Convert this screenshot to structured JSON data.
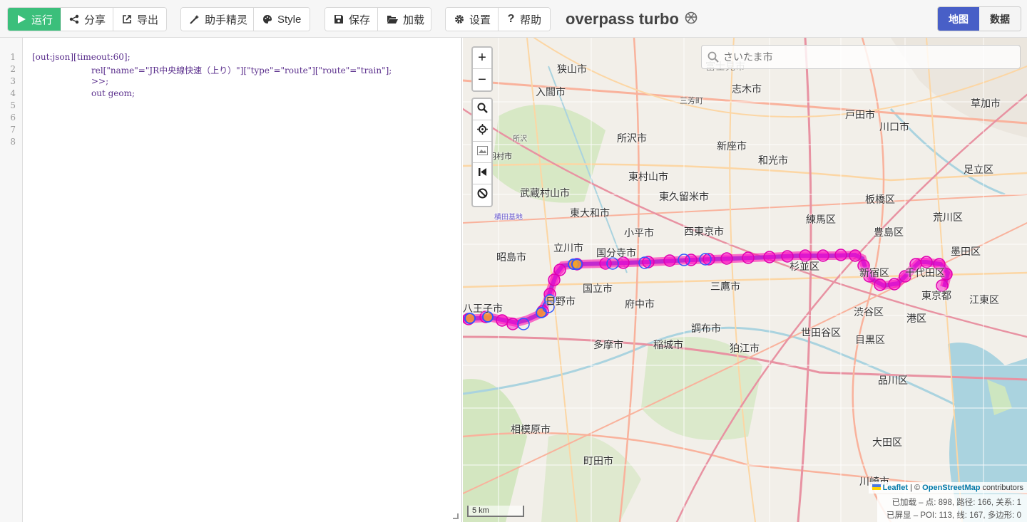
{
  "toolbar": {
    "run": "运行",
    "share": "分享",
    "export": "导出",
    "wizard": "助手精灵",
    "style": "Style",
    "save": "保存",
    "load": "加载",
    "settings": "设置",
    "help": "帮助"
  },
  "app_title": "overpass turbo",
  "view_tabs": {
    "map": "地图",
    "data": "数据"
  },
  "editor": {
    "line_numbers": [
      "1",
      "2",
      "3",
      "4",
      "5",
      "6",
      "7",
      "8"
    ],
    "lines": [
      "[out:json][timeout:60];",
      "rel[\"name\"=\"JR中央線快速（上り）\"][\"type\"=\"route\"][\"route\"=\"train\"];",
      ">>;",
      "out geom;"
    ]
  },
  "map": {
    "search_placeholder": "さいたま市",
    "attribution": {
      "leaflet": "Leaflet",
      "sep": " | © ",
      "osm": "OpenStreetMap",
      "contrib": " contributors"
    },
    "stats": {
      "loaded": "已加载 – 点: 898, 路径: 166, 关系: 1",
      "displayed": "已屏显 – POI: 113, 线: 167, 多边形: 0"
    },
    "scale": "5 km",
    "labels": [
      {
        "t": "狭山市"
      },
      {
        "t": "入間市"
      },
      {
        "t": "富士見市"
      },
      {
        "t": "志木市"
      },
      {
        "t": "三芳町"
      },
      {
        "t": "戸田市"
      },
      {
        "t": "川口市"
      },
      {
        "t": "草加市"
      },
      {
        "t": "所沢市"
      },
      {
        "t": "新座市"
      },
      {
        "t": "和光市"
      },
      {
        "t": "羽村市"
      },
      {
        "t": "東村山市"
      },
      {
        "t": "足立区"
      },
      {
        "t": "武蔵村山市"
      },
      {
        "t": "東久留米市"
      },
      {
        "t": "板橋区"
      },
      {
        "t": "東大和市"
      },
      {
        "t": "練馬区"
      },
      {
        "t": "荒川区"
      },
      {
        "t": "小平市"
      },
      {
        "t": "西東京市"
      },
      {
        "t": "豊島区"
      },
      {
        "t": "立川市"
      },
      {
        "t": "国分寺市"
      },
      {
        "t": "墨田区"
      },
      {
        "t": "昭島市"
      },
      {
        "t": "杉並区"
      },
      {
        "t": "新宿区"
      },
      {
        "t": "千代田区"
      },
      {
        "t": "国立市"
      },
      {
        "t": "三鷹市"
      },
      {
        "t": "東京都"
      },
      {
        "t": "江東区"
      },
      {
        "t": "日野市"
      },
      {
        "t": "府中市"
      },
      {
        "t": "渋谷区"
      },
      {
        "t": "港区"
      },
      {
        "t": "八王子市"
      },
      {
        "t": "調布市"
      },
      {
        "t": "世田谷区"
      },
      {
        "t": "目黒区"
      },
      {
        "t": "多摩市"
      },
      {
        "t": "稲城市"
      },
      {
        "t": "狛江市"
      },
      {
        "t": "品川区"
      },
      {
        "t": "相模原市"
      },
      {
        "t": "町田市"
      },
      {
        "t": "大田区"
      },
      {
        "t": "川崎市"
      },
      {
        "t": "横田基地"
      },
      {
        "t": "所沢"
      }
    ]
  },
  "colors": {
    "run": "#3bbf7b",
    "tab_active": "#485fc7",
    "route": "#5a5aff",
    "stop": "#ff00cc"
  }
}
